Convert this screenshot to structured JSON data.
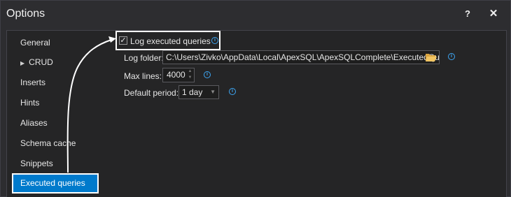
{
  "window": {
    "title": "Options",
    "help_label": "?",
    "close_label": "✕"
  },
  "sidebar": {
    "items": [
      {
        "label": "General",
        "expandable": false,
        "selected": false
      },
      {
        "label": "CRUD",
        "expandable": true,
        "selected": false
      },
      {
        "label": "Inserts",
        "expandable": false,
        "selected": false
      },
      {
        "label": "Hints",
        "expandable": false,
        "selected": false
      },
      {
        "label": "Aliases",
        "expandable": false,
        "selected": false
      },
      {
        "label": "Schema cache",
        "expandable": false,
        "selected": false
      },
      {
        "label": "Snippets",
        "expandable": false,
        "selected": false
      },
      {
        "label": "Executed queries",
        "expandable": false,
        "selected": true
      }
    ]
  },
  "settings": {
    "log_executed_queries": {
      "label": "Log executed queries",
      "checked": true
    },
    "log_folder": {
      "label": "Log folder:",
      "value": "C:\\Users\\Zivko\\AppData\\Local\\ApexSQL\\ApexSQLComplete\\ExecutedQueries"
    },
    "max_lines": {
      "label": "Max lines:",
      "value": "4000"
    },
    "default_period": {
      "label": "Default period:",
      "value": "1 day"
    }
  },
  "icons": {
    "info": "info-icon",
    "folder": "folder-open-icon",
    "caret": "chevron-down-icon",
    "check": "check-icon",
    "expand": "triangle-right-icon"
  },
  "colors": {
    "accent": "#007acc",
    "info": "#3da7f5",
    "background": "#2d2d30",
    "panel": "#252526",
    "highlight_frame": "#ffffff"
  }
}
